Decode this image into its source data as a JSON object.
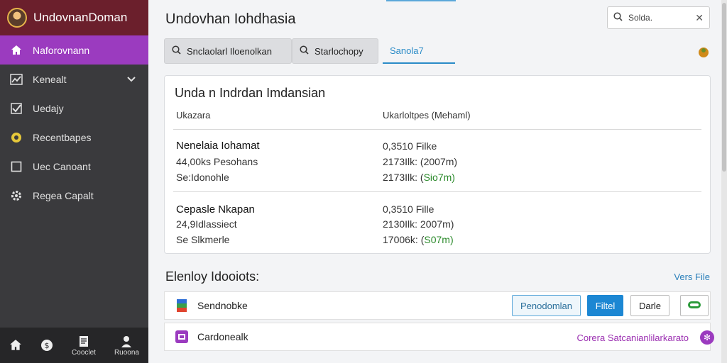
{
  "sidebar": {
    "title": "UndovnanDoman",
    "items": [
      {
        "label": "Naforovnann",
        "icon": "home-icon",
        "active": true
      },
      {
        "label": "Kenealt",
        "icon": "chart-icon",
        "expandable": true
      },
      {
        "label": "Uedajy",
        "icon": "checkbox-icon"
      },
      {
        "label": "Recentbapes",
        "icon": "circle-icon"
      },
      {
        "label": "Uec Canoant",
        "icon": "square-icon"
      },
      {
        "label": "Regea Capalt",
        "icon": "gear-icon"
      }
    ],
    "bottom": [
      {
        "label": "",
        "icon": "home-icon"
      },
      {
        "label": "",
        "icon": "dollar-icon"
      },
      {
        "label": "Cooclet",
        "icon": "document-icon"
      },
      {
        "label": "Ruoona",
        "icon": "user-icon"
      }
    ]
  },
  "header": {
    "title": "Undovhan Iohdhasia",
    "search": {
      "value": "Solda."
    }
  },
  "tabs": [
    {
      "label": "Snclaolarl Iloenolkan",
      "icon": "search-icon"
    },
    {
      "label": "Starlochopy",
      "icon": "search-icon"
    },
    {
      "label": "Sanola7",
      "icon": ""
    }
  ],
  "card": {
    "title": "Unda n Indrdan Imdansian",
    "col1_header": "Ukazara",
    "col2_header": "Ukarloltpes (Mehaml)",
    "groups": [
      {
        "name": "Nenelaia Iohamat",
        "line2": "44,00ks Pesohans",
        "line3": "Se:Idonohle",
        "v1": "0,3510 Filke",
        "v2": "2173Ilk: (2007m)",
        "v3_prefix": "2173Ilk: (",
        "v3_green": "Sio7m",
        "v3_suffix": ")"
      },
      {
        "name": "Cepasle Nkapan",
        "line2": "24,9Idlassiect",
        "line3": "Se Slkmerle",
        "v1": "0,3510 Fille",
        "v2": "2130Ilk: 2007m)",
        "v3_prefix": "17006k: (",
        "v3_green": "S07m",
        "v3_suffix": ")"
      }
    ]
  },
  "section": {
    "title": "Elenloy Idooiots:",
    "link": "Vers File"
  },
  "rows": [
    {
      "label": "Sendnobke",
      "icon": "stacked-file-icon",
      "buttons": [
        "Penodomlan",
        "Filtel",
        "Darle"
      ]
    },
    {
      "label": "Cardonealk",
      "icon": "purple-app-icon",
      "link": "Corera Satcanianlilarkarato",
      "badge": "✻"
    }
  ],
  "colors": {
    "sidebar_bg": "#3a3a3d",
    "sidebar_header": "#6b1f2c",
    "accent_purple": "#9b3bbf",
    "accent_blue": "#1c87d3",
    "green": "#2b8a2b"
  }
}
